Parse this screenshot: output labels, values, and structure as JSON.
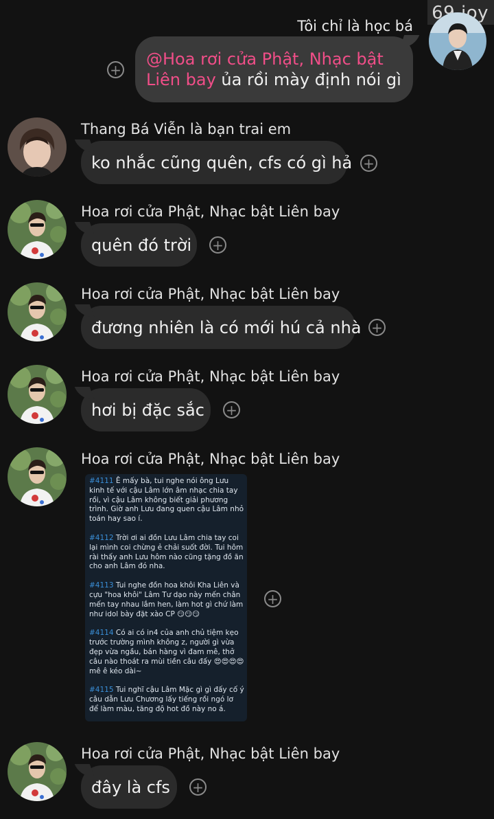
{
  "watermark": "69 joy",
  "own_message": {
    "sender": "Tôi chỉ là học bá",
    "mention": "@Hoa rơi cửa Phật, Nhạc bật Liên bay",
    "text": " ủa rồi mày định nói gì"
  },
  "messages": [
    {
      "sender": "Thang Bá Viễn là bạn trai em",
      "text": "ko nhắc cũng quên, cfs có gì hả"
    },
    {
      "sender": "Hoa rơi cửa Phật, Nhạc bật Liên bay",
      "text": "quên đó trời"
    },
    {
      "sender": "Hoa rơi cửa Phật, Nhạc bật Liên bay",
      "text": "đương nhiên là có mới hú cả nhà"
    },
    {
      "sender": "Hoa rơi cửa Phật, Nhạc bật Liên bay",
      "text": "hơi bị đặc sắc"
    },
    {
      "sender": "Hoa rơi cửa Phật, Nhạc bật Liên bay"
    },
    {
      "sender": "Hoa rơi cửa Phật, Nhạc bật Liên bay",
      "text": "đây là cfs"
    }
  ],
  "screenshot_posts": [
    {
      "num": "#4111",
      "text": " Ê mấy bà, tui nghe nói ông Lưu kinh tế với cậu Lâm lớn âm nhạc chia tay rồi, vì cậu Lâm không biết giải phương trình. Giờ anh Lưu đang quen cậu Lâm nhỏ toán hay sao í."
    },
    {
      "num": "#4112",
      "text": " Trời ơi ai đồn Lưu Lâm chia tay coi lại mình coi chừng ẻ chải suốt đời. Tui hôm rài thấy anh Lưu hôm nào cũng tặng đồ ăn cho anh Lâm đó nha."
    },
    {
      "num": "#4113",
      "text": " Tui nghe đồn hoa khôi Kha Liên và cựu \"hoa khôi\" Lâm Tư dạo này mến chân mến tay nhau lắm hen, làm hot gì chứ làm như idol bày đặt xào CP 😏😏😏"
    },
    {
      "num": "#4114",
      "text": " Có ai có in4 của anh chủ tiệm kẹo trước trường mình không z, người gì vừa đẹp vừa ngầu, bán hàng vì đam mê, thở câu nào thoát ra mùi tiền câu đấy 😍😍😍😍 mê ê kéo dài~"
    },
    {
      "num": "#4115",
      "text": " Tui nghĩ cậu Lâm Mặc gì gì đấy cố ý câu dẫn Lưu Chương lấy tiếng rồi ngó lơ để làm màu, tăng độ hot đồ này no á."
    }
  ],
  "react_icon": "+",
  "colors": {
    "background": "#121212",
    "bubble": "#2b2b2b",
    "own_bubble": "#3a3a3a",
    "mention": "#f04e88",
    "post_number": "#3a8fd8"
  }
}
